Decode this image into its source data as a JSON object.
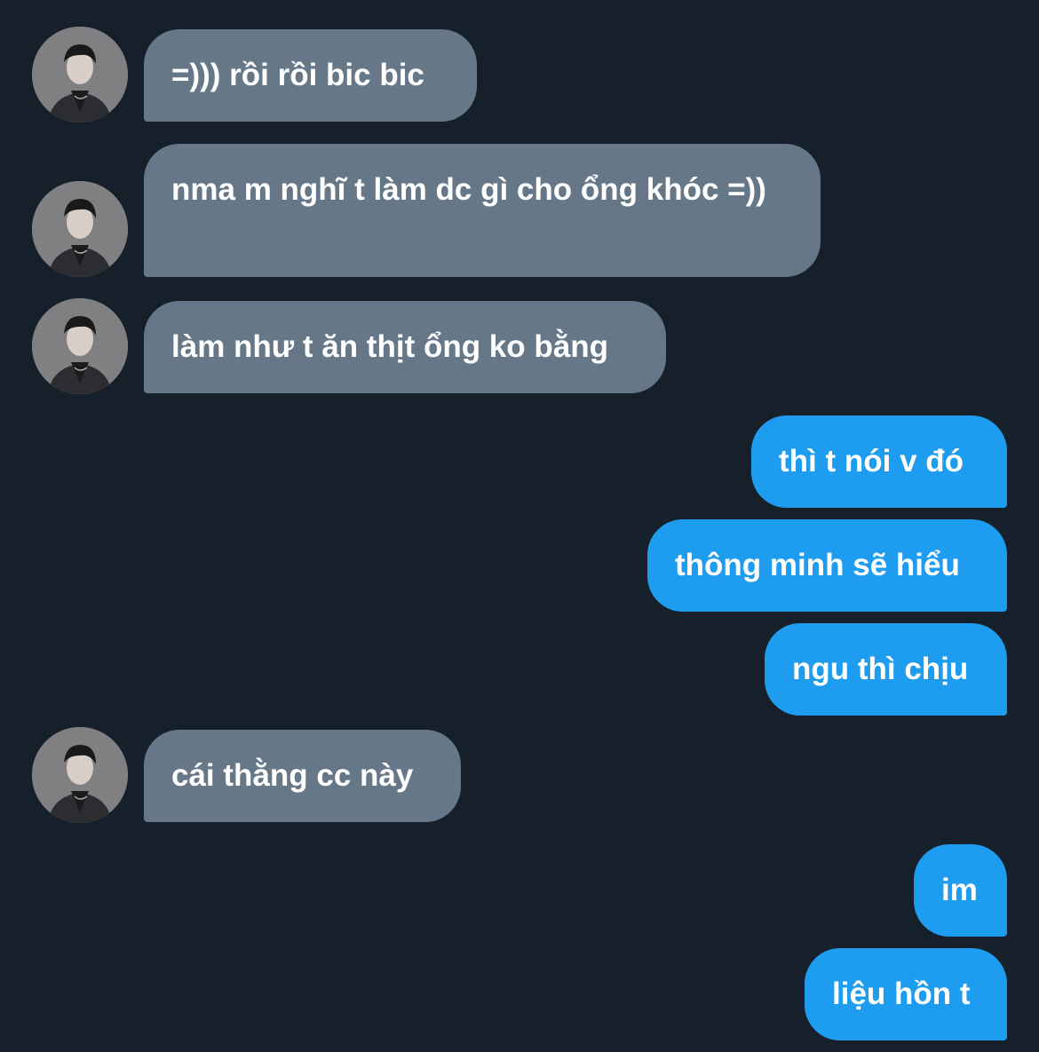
{
  "conversation": {
    "messages": [
      {
        "side": "incoming",
        "text": "=))) rồi rồi bic bic"
      },
      {
        "side": "incoming",
        "text": "nma m nghĩ t làm dc gì cho ổng khóc =))"
      },
      {
        "side": "incoming",
        "text": "làm như t ăn thịt ổng ko bằng"
      },
      {
        "side": "outgoing",
        "text": "thì t nói v đó"
      },
      {
        "side": "outgoing",
        "text": "thông minh sẽ hiểu"
      },
      {
        "side": "outgoing",
        "text": "ngu thì chịu"
      },
      {
        "side": "incoming",
        "text": "cái thằng cc này"
      },
      {
        "side": "outgoing",
        "text": "im"
      },
      {
        "side": "outgoing",
        "text": "liệu hồn t"
      }
    ]
  },
  "colors": {
    "background": "#16202b",
    "incoming_bubble": "#667888",
    "outgoing_bubble": "#1e9cf0",
    "text": "#ffffff"
  },
  "icons": {
    "avatar": "contact-avatar-photo"
  }
}
